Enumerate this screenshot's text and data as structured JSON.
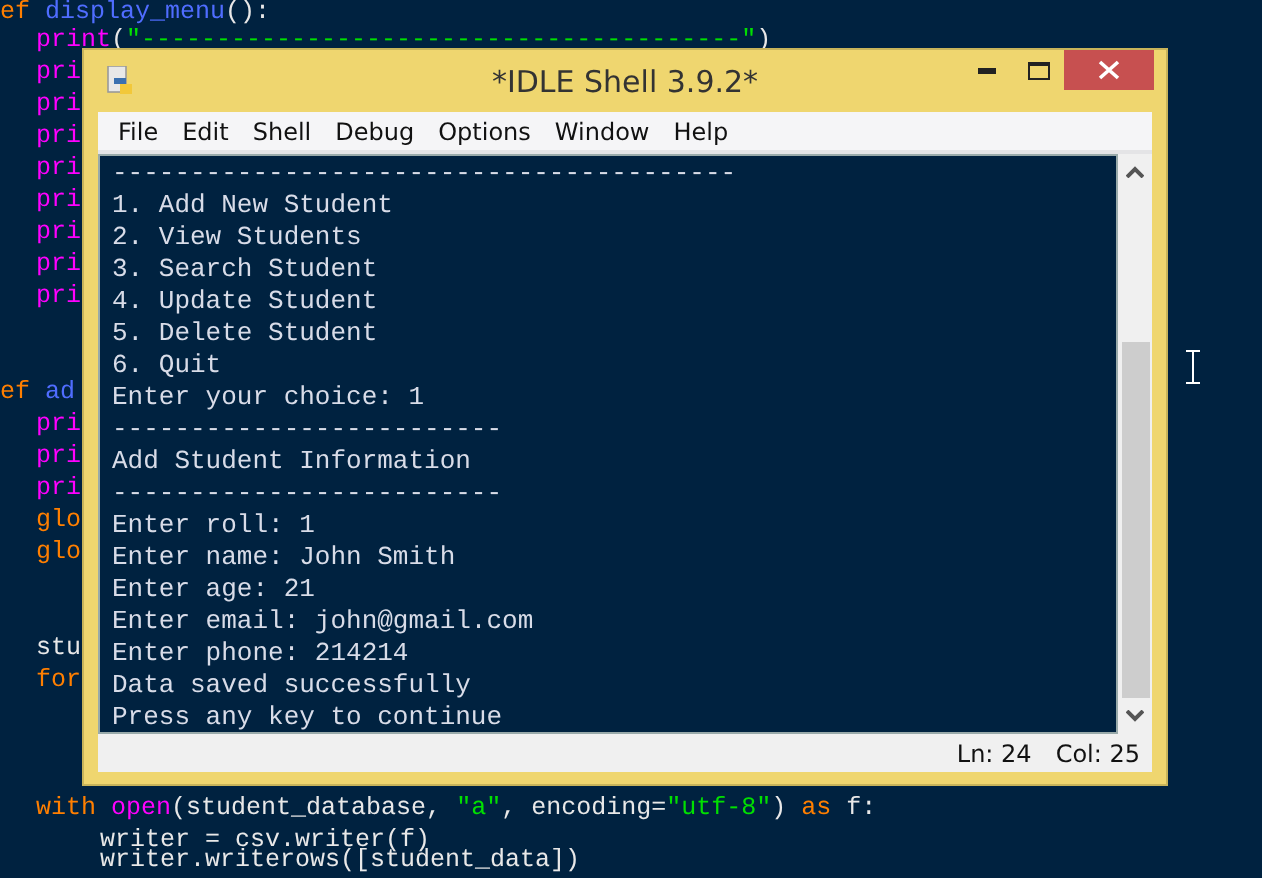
{
  "editor": {
    "lines": [
      {
        "kind": "code",
        "segments": [
          {
            "kind": "keyword",
            "text": "ef"
          },
          {
            "kind": "name",
            "text": " display_menu"
          },
          {
            "kind": "plain",
            "text": "():"
          }
        ],
        "children": [
          {
            "kind": "code",
            "segments": [
              {
                "kind": "builtin",
                "text": "print"
              },
              {
                "kind": "plain",
                "text": "("
              },
              {
                "kind": "string",
                "text": "\"----------------------------------------\""
              },
              {
                "kind": "plain",
                "text": ")"
              }
            ]
          },
          {
            "kind": "code",
            "segments": [
              {
                "kind": "builtin",
                "text": "pri"
              }
            ]
          },
          {
            "kind": "code",
            "segments": [
              {
                "kind": "builtin",
                "text": "pri"
              }
            ]
          },
          {
            "kind": "code",
            "segments": [
              {
                "kind": "builtin",
                "text": "pri"
              }
            ]
          },
          {
            "kind": "code",
            "segments": [
              {
                "kind": "builtin",
                "text": "pri"
              }
            ]
          },
          {
            "kind": "code",
            "segments": [
              {
                "kind": "builtin",
                "text": "pri"
              }
            ]
          },
          {
            "kind": "code",
            "segments": [
              {
                "kind": "builtin",
                "text": "pri"
              }
            ]
          },
          {
            "kind": "code",
            "segments": [
              {
                "kind": "builtin",
                "text": "pri"
              }
            ]
          },
          {
            "kind": "code",
            "segments": [
              {
                "kind": "builtin",
                "text": "pri"
              }
            ]
          },
          {
            "kind": "blank"
          },
          {
            "kind": "blank"
          }
        ]
      },
      {
        "kind": "code",
        "segments": [
          {
            "kind": "keyword",
            "text": "ef"
          },
          {
            "kind": "name",
            "text": " ad"
          }
        ],
        "children": [
          {
            "kind": "code",
            "segments": [
              {
                "kind": "builtin",
                "text": "pri"
              }
            ]
          },
          {
            "kind": "code",
            "segments": [
              {
                "kind": "builtin",
                "text": "pri"
              }
            ]
          },
          {
            "kind": "code",
            "segments": [
              {
                "kind": "builtin",
                "text": "pri"
              }
            ]
          },
          {
            "kind": "code",
            "segments": [
              {
                "kind": "keyword",
                "text": "glo"
              }
            ]
          },
          {
            "kind": "code",
            "segments": [
              {
                "kind": "keyword",
                "text": "glo"
              }
            ]
          },
          {
            "kind": "blank"
          },
          {
            "kind": "blank"
          },
          {
            "kind": "code",
            "segments": [
              {
                "kind": "plain",
                "text": "stu"
              }
            ]
          },
          {
            "kind": "code",
            "segments": [
              {
                "kind": "keyword",
                "text": "for"
              }
            ]
          },
          {
            "kind": "blank"
          },
          {
            "kind": "blank"
          },
          {
            "kind": "blank"
          },
          {
            "kind": "code",
            "segments": [
              {
                "kind": "keyword",
                "text": "with"
              },
              {
                "kind": "builtin",
                "text": " open"
              },
              {
                "kind": "plain",
                "text": "(student_database, "
              },
              {
                "kind": "string",
                "text": "\"a\""
              },
              {
                "kind": "plain",
                "text": ", encoding="
              },
              {
                "kind": "string",
                "text": "\"utf-8\""
              },
              {
                "kind": "plain",
                "text": ")"
              },
              {
                "kind": "keyword",
                "text": " as"
              },
              {
                "kind": "plain",
                "text": " f:"
              }
            ],
            "children": [
              {
                "kind": "code",
                "segments": [
                  {
                    "kind": "plain",
                    "text": "writer = csv.writer(f)"
                  }
                ]
              },
              {
                "kind": "code",
                "segments": [
                  {
                    "kind": "plain",
                    "text": "writer.writerows([student_data])"
                  }
                ]
              }
            ]
          }
        ]
      }
    ]
  },
  "window": {
    "title": "*IDLE Shell 3.9.2*",
    "menu": [
      "File",
      "Edit",
      "Shell",
      "Debug",
      "Options",
      "Window",
      "Help"
    ],
    "shell_lines": [
      "----------------------------------------",
      "1. Add New Student",
      "2. View Students",
      "3. Search Student",
      "4. Update Student",
      "5. Delete Student",
      "6. Quit",
      "Enter your choice: 1",
      "-------------------------",
      "Add Student Information",
      "-------------------------",
      "Enter roll: 1",
      "Enter name: John Smith",
      "Enter age: 21",
      "Enter email: john@gmail.com",
      "Enter phone: 214214",
      "Data saved successfully",
      "Press any key to continue"
    ],
    "status_bar": {
      "line": "Ln: 24",
      "column": "Col: 25"
    }
  }
}
